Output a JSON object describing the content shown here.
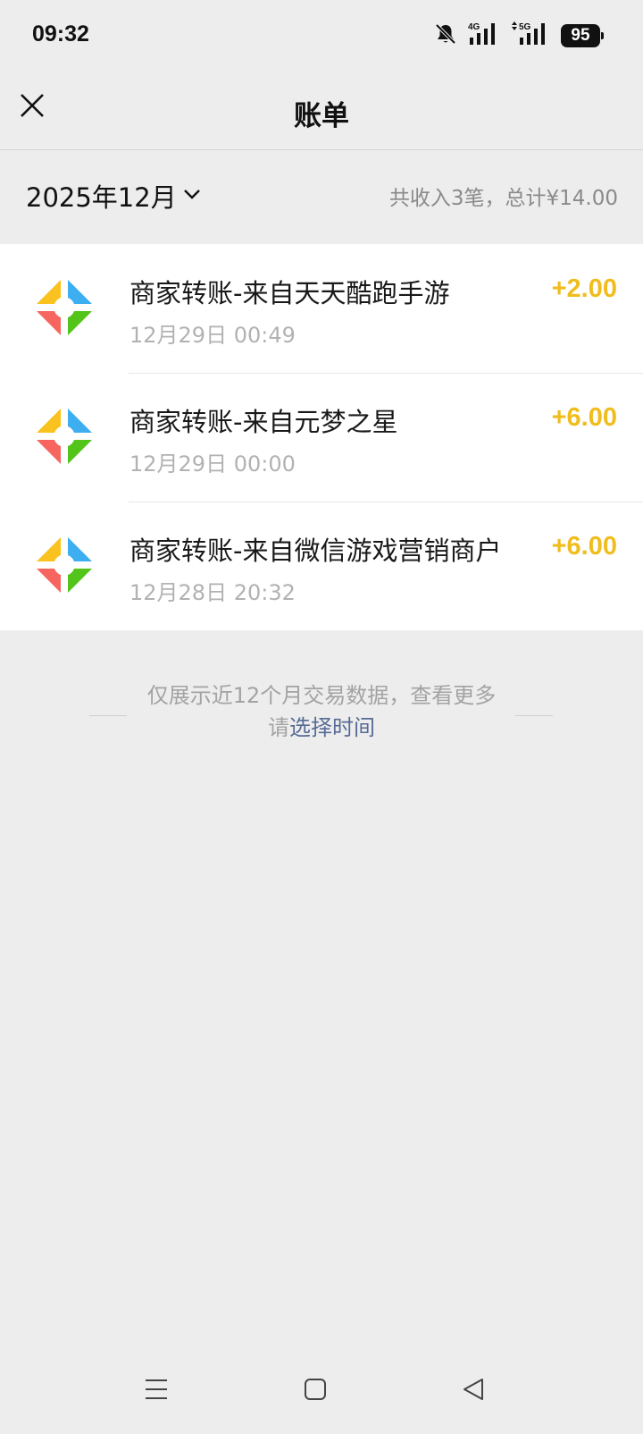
{
  "status_bar": {
    "time": "09:32",
    "battery": "95",
    "icons": [
      "bell-muted-icon",
      "signal-4g-icon",
      "signal-5g-icon",
      "battery-icon"
    ]
  },
  "nav": {
    "title": "账单",
    "close_icon": "close-icon"
  },
  "month": {
    "label": "2025年12月",
    "summary": "共收入3笔，总计¥14.00"
  },
  "transactions": [
    {
      "title": "商家转账-来自天天酷跑手游",
      "time": "12月29日 00:49",
      "amount": "+2.00"
    },
    {
      "title": "商家转账-来自元梦之星",
      "time": "12月29日 00:00",
      "amount": "+6.00"
    },
    {
      "title": "商家转账-来自微信游戏营销商户",
      "time": "12月28日 20:32",
      "amount": "+6.00"
    }
  ],
  "note": {
    "text": "仅展示近12个月交易数据，查看更多请",
    "link": "选择时间"
  },
  "colors": {
    "background": "#ededed",
    "amount": "#f0bd1e",
    "link": "#576b95"
  }
}
